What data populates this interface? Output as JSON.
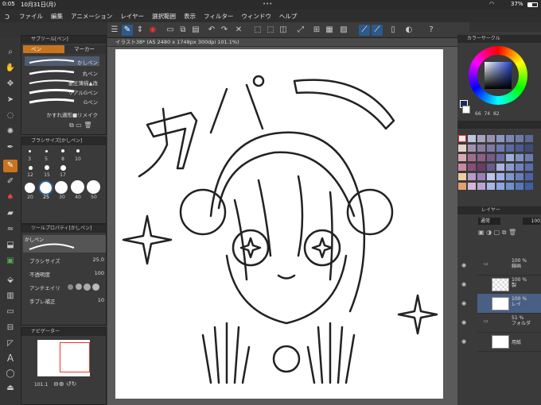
{
  "status": {
    "time": "0:05",
    "date": "10月31日(月)",
    "dots": "•••",
    "battery": "37%"
  },
  "menu": [
    "ファイル",
    "編集",
    "アニメーション",
    "レイヤー",
    "選択範囲",
    "表示",
    "フィルター",
    "ウィンドウ",
    "ヘルプ"
  ],
  "subtool": {
    "header": "サブツール[ペン]",
    "tab_pen": "ペン",
    "tab_marker": "マーカー",
    "brushes": [
      "かしペン",
      "丸ペン",
      "筆圧薄描▲改",
      "リアルGペン",
      "Gペン",
      "かすれ適形■リメイク"
    ]
  },
  "brush_size": {
    "header": "ブラシサイズ[かしペン]",
    "sizes": [
      "3",
      "5",
      "8",
      "10",
      "12",
      "15",
      "17",
      "20",
      "25",
      "30",
      "40",
      "50"
    ]
  },
  "tool_property": {
    "header": "ツールプロパティ[かしペン]",
    "brush_name": "かしペン",
    "rows": [
      {
        "label": "ブラシサイズ",
        "value": "25.0"
      },
      {
        "label": "不透明度",
        "value": "100"
      },
      {
        "label": "アンチエイリ",
        "value": ""
      },
      {
        "label": "手ブレ補正",
        "value": "10"
      }
    ]
  },
  "navigator": {
    "header": "ナビゲーター",
    "zoom": "101.1"
  },
  "document": {
    "tab": "イラスト38* (A5 2480 x 1748px 300dpi 101.1%)"
  },
  "artwork": {
    "title_text": "カパー"
  },
  "color_circle": {
    "header": "カラーサークル",
    "h": "66",
    "s": "74",
    "v": "82"
  },
  "layers": {
    "header": "レイヤー",
    "blend": "通常",
    "opacity": "100",
    "items": [
      {
        "pct": "100 %",
        "name": "線画"
      },
      {
        "pct": "100 %",
        "name": "製"
      },
      {
        "pct": "100 %",
        "name": "レイ"
      },
      {
        "pct": "51 %",
        "name": "フォルダ"
      },
      {
        "pct": "",
        "name": "用紙"
      }
    ]
  },
  "colors": {
    "accent": "#c8741e",
    "selected": "#2d5a8a"
  }
}
